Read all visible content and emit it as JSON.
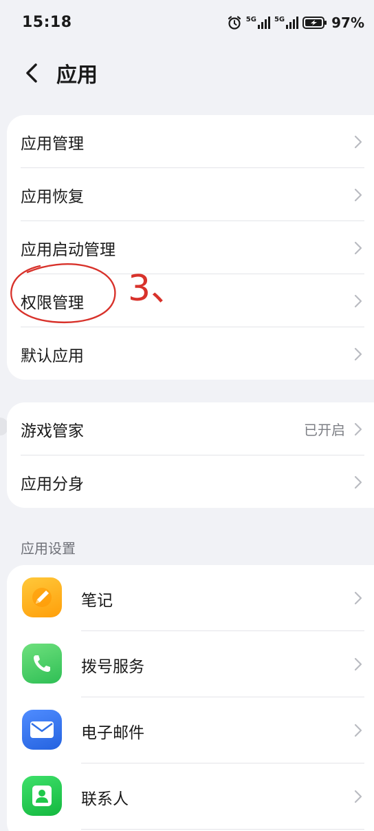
{
  "status_bar": {
    "time": "15:18",
    "signal_1": "5G",
    "signal_2": "5G",
    "battery": "97%"
  },
  "header": {
    "title": "应用"
  },
  "group1": {
    "items": [
      {
        "label": "应用管理"
      },
      {
        "label": "应用恢复"
      },
      {
        "label": "应用启动管理"
      },
      {
        "label": "权限管理"
      },
      {
        "label": "默认应用"
      }
    ]
  },
  "group2": {
    "items": [
      {
        "label": "游戏管家",
        "value": "已开启"
      },
      {
        "label": "应用分身"
      }
    ]
  },
  "app_settings": {
    "section_label": "应用设置",
    "apps": [
      {
        "name": "笔记",
        "icon": "notes-icon",
        "color": "#ffb300"
      },
      {
        "name": "拨号服务",
        "icon": "phone-icon",
        "color": "#34c759"
      },
      {
        "name": "电子邮件",
        "icon": "mail-icon",
        "color": "#2f6fe6"
      },
      {
        "name": "联系人",
        "icon": "contacts-icon",
        "color": "#1fc84a"
      }
    ]
  },
  "annotation": {
    "note": "3、",
    "color": "#d8322b"
  }
}
